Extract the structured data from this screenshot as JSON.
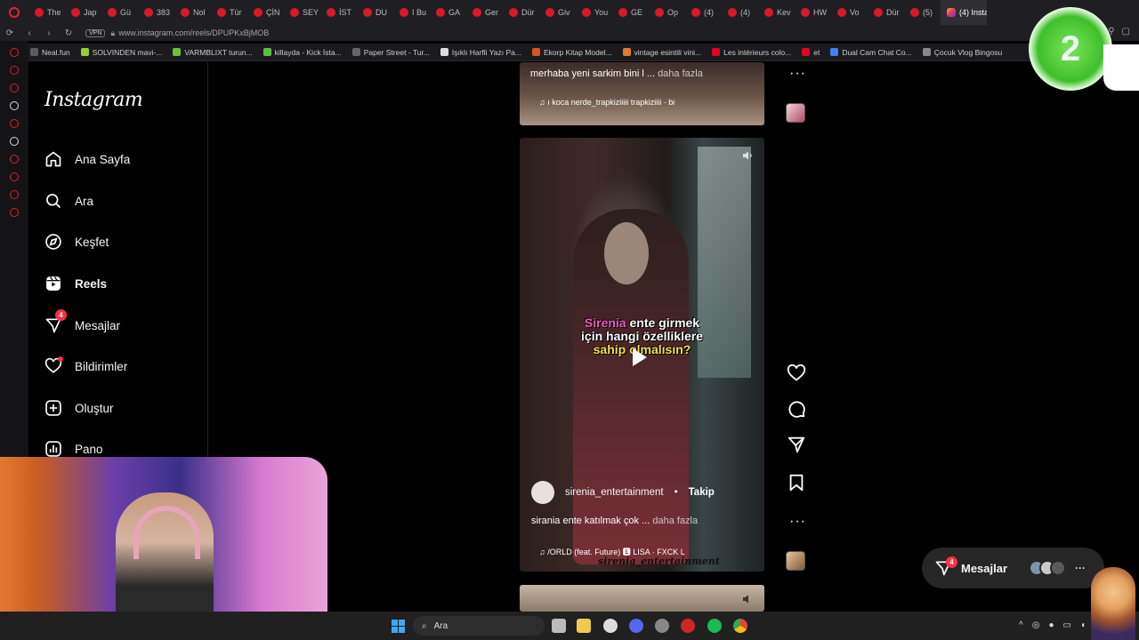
{
  "browser": {
    "tabs": [
      "The",
      "Jap",
      "Gü",
      "383",
      "Nol",
      "Tür",
      "ÇİN",
      "SEY",
      "İST",
      "DU",
      "I Bu",
      "GA",
      "Ger",
      "Dür",
      "Giv",
      "You",
      "GE",
      "Op",
      "(4)",
      "(4)",
      "Kev",
      "HW",
      "Vo",
      "Dür",
      "(5)",
      "(4) Insta"
    ],
    "vpn_label": "VPN",
    "url": "www.instagram.com/reels/DPUPKxBjMOB",
    "bookmarks": [
      "Neal.fun",
      "SOLVINDEN mavi-...",
      "VARMBLIXT turun...",
      "killayda - Kick İsta...",
      "Paper Street - Tur...",
      "Işıklı Harfli Yazı Pa...",
      "Ekorp Kitap Model...",
      "vintage esintili vini...",
      "Les intérieurs colo...",
      "et",
      "Dual Cam Chat Co...",
      "Çocuk Vlog Bingosu"
    ]
  },
  "instagram": {
    "logo": "Instagram",
    "nav": [
      {
        "label": "Ana Sayfa",
        "icon": "home-icon"
      },
      {
        "label": "Ara",
        "icon": "search-icon"
      },
      {
        "label": "Keşfet",
        "icon": "explore-icon"
      },
      {
        "label": "Reels",
        "icon": "reels-icon"
      },
      {
        "label": "Mesajlar",
        "icon": "messenger-icon",
        "badge": "4"
      },
      {
        "label": "Bildirimler",
        "icon": "heart-icon"
      },
      {
        "label": "Oluştur",
        "icon": "plus-square-icon"
      },
      {
        "label": "Pano",
        "icon": "dashboard-icon"
      }
    ]
  },
  "reels": {
    "top": {
      "caption": "merhaba yeni sarkim bini l ...",
      "more": "daha fazla",
      "music": "♫ ı koca nerde_trapkiziiiii   trapkiziiii · bi"
    },
    "main": {
      "overlay_line1_pink": "Sirenia",
      "overlay_line1_rest": " ente girmek",
      "overlay_line2": "için hangi özelliklere",
      "overlay_line3": "sahip olmalısın?",
      "author": "sirenia_entertainment",
      "separator": "•",
      "follow": "Takip",
      "caption": "sirania ente katılmak çok ...",
      "more": "daha fazla",
      "music": "♫ /ORLD (feat. Future) 🅴  LISA · FXCK L",
      "watermark": "sirenia_entertainment"
    }
  },
  "messages_pill": {
    "label": "Mesajlar",
    "badge": "4"
  },
  "stream_overlay": {
    "number": "2"
  },
  "taskbar": {
    "search_label": "Ara"
  },
  "colors": {
    "accent_red": "#ff3040",
    "background": "#000000",
    "windows_blue": "#3fa8f4"
  }
}
